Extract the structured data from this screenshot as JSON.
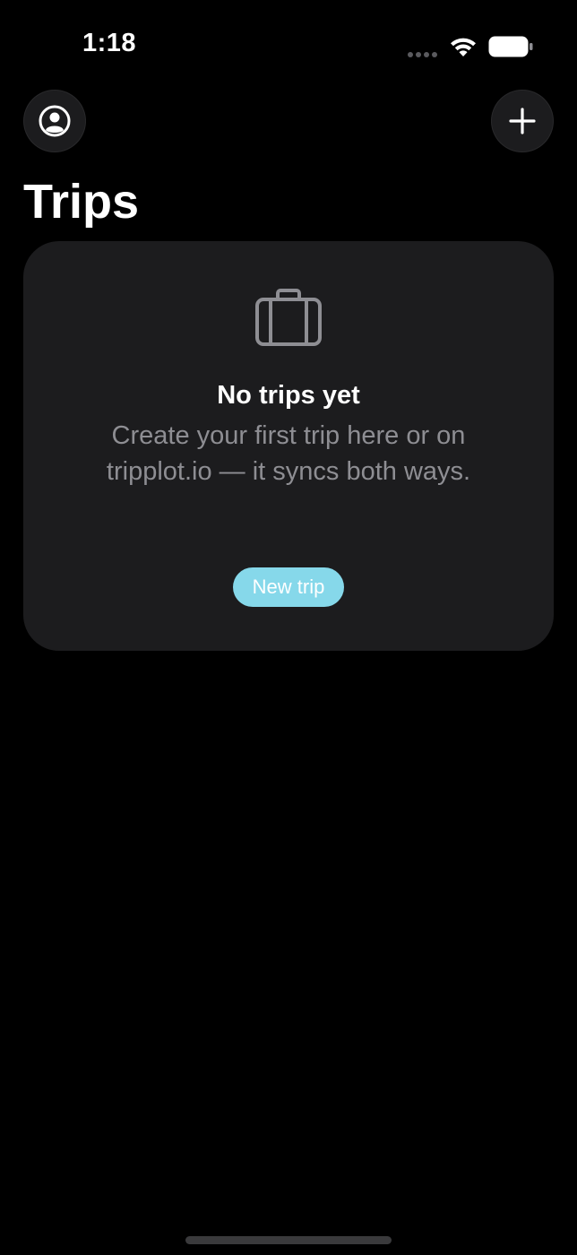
{
  "status_bar": {
    "time": "1:18",
    "signal_icon": "signal-dots-icon",
    "wifi_icon": "wifi-icon",
    "battery_icon": "battery-full-icon"
  },
  "nav": {
    "profile_icon": "person-circle-icon",
    "add_icon": "plus-icon"
  },
  "page": {
    "title": "Trips"
  },
  "empty_state": {
    "icon": "suitcase-icon",
    "title": "No trips yet",
    "description": "Create your first trip here or on tripplot.io — it syncs both ways.",
    "button_label": "New trip"
  },
  "colors": {
    "background": "#000000",
    "card": "#1c1c1e",
    "accent": "#86d8ea",
    "secondary_text": "#8e8e93"
  }
}
